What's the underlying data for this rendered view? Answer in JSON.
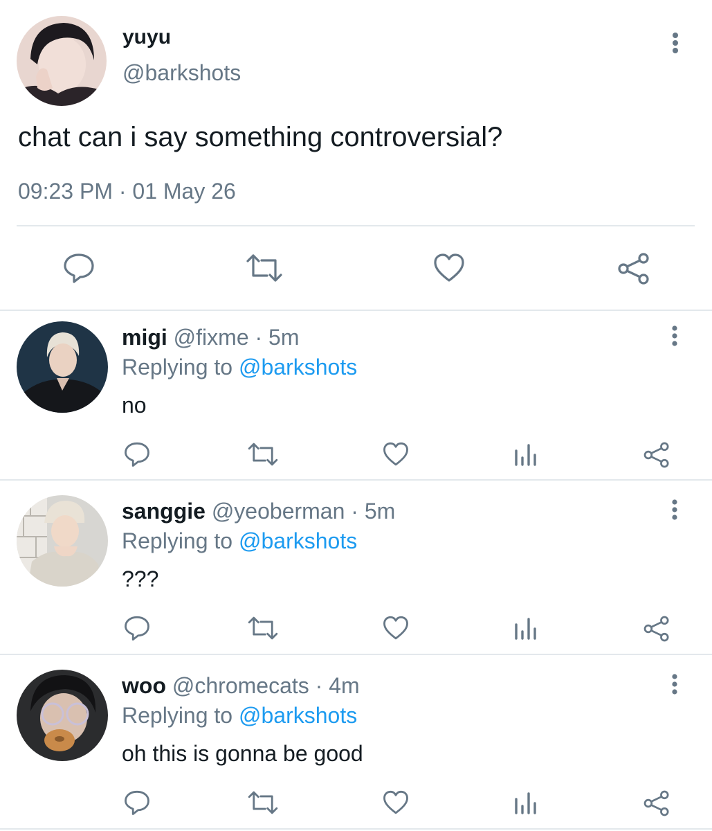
{
  "main_tweet": {
    "name": "yuyu",
    "handle": "@barkshots",
    "text": "chat can i say something controversial?",
    "timestamp": "09:23 PM · 01 May 26",
    "avatar": "avatar-photo",
    "actions": [
      "reply-icon",
      "retweet-icon",
      "like-icon",
      "share-icon"
    ]
  },
  "replies": [
    {
      "name": "migi",
      "handle": "@fixme",
      "time": "· 5m",
      "replying_label": "Replying to",
      "replying_to": "@barkshots",
      "text": "no"
    },
    {
      "name": "sanggie",
      "handle": "@yeoberman",
      "time": "· 5m",
      "replying_label": "Replying to",
      "replying_to": "@barkshots",
      "text": "???"
    },
    {
      "name": "woo",
      "handle": "@chromecats",
      "time": "· 4m",
      "replying_label": "Replying to",
      "replying_to": "@barkshots",
      "text": "oh this is gonna be good"
    }
  ],
  "colors": {
    "text": "#141c22",
    "muted": "#667786",
    "accent": "#1d9bf0",
    "divider": "#e3e8ec"
  }
}
